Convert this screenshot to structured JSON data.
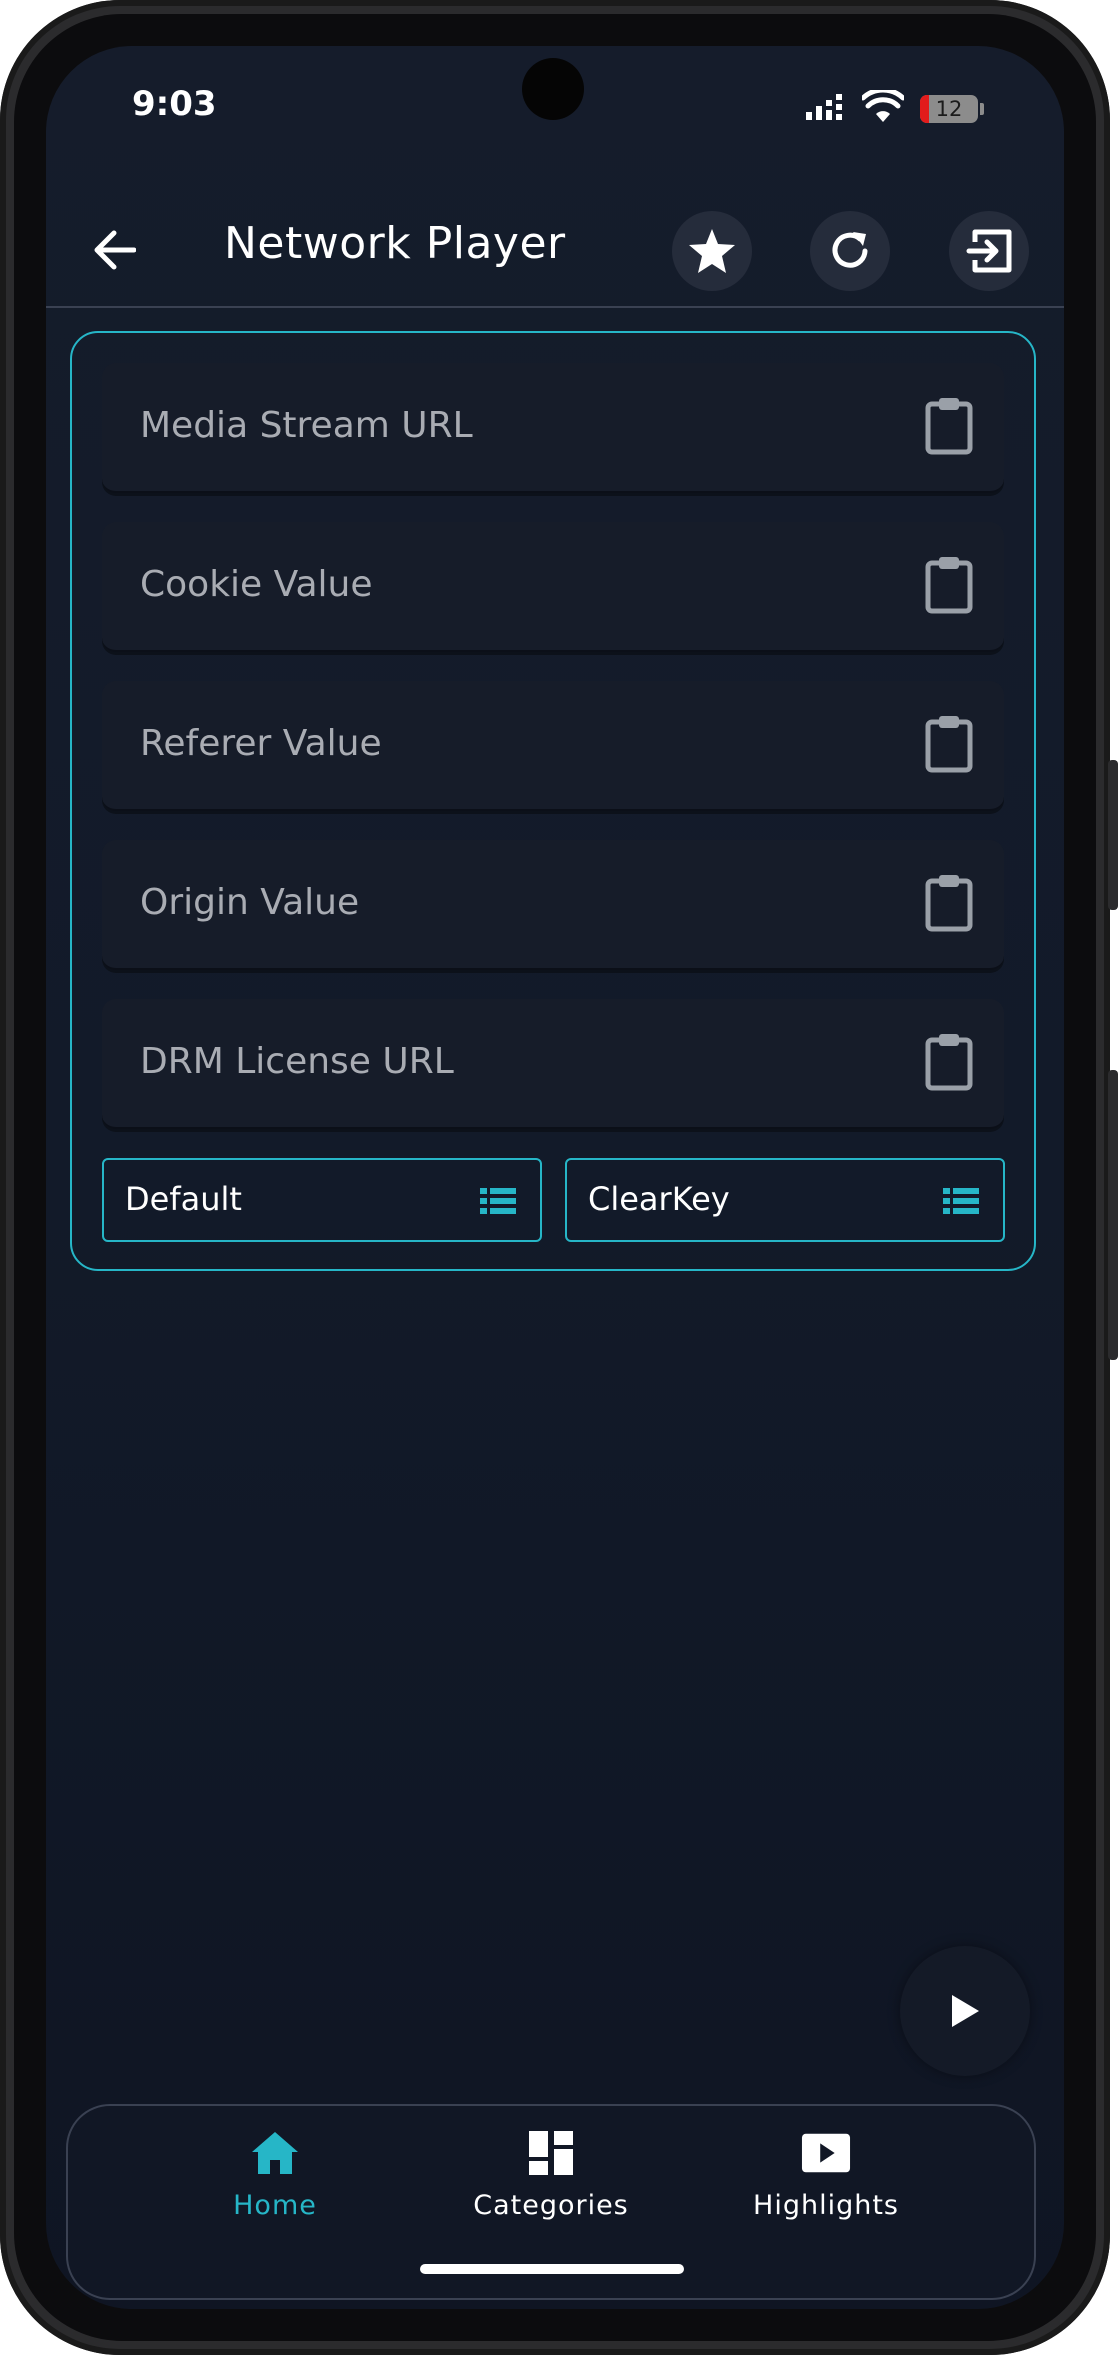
{
  "status_bar": {
    "time": "9:03",
    "battery_level": "12",
    "icons": [
      "signal-icon",
      "wifi-icon",
      "battery-icon"
    ]
  },
  "app_bar": {
    "title": "Network Player",
    "actions": [
      "star-icon",
      "refresh-icon",
      "exit-icon"
    ]
  },
  "form": {
    "fields": [
      {
        "placeholder": "Media Stream URL"
      },
      {
        "placeholder": "Cookie Value"
      },
      {
        "placeholder": "Referer Value"
      },
      {
        "placeholder": "Origin Value"
      },
      {
        "placeholder": "DRM License URL"
      }
    ],
    "selects": [
      {
        "value": "Default"
      },
      {
        "value": "ClearKey"
      }
    ]
  },
  "bottom_nav": {
    "items": [
      {
        "label": "Home",
        "icon": "home-icon",
        "active": true
      },
      {
        "label": "Categories",
        "icon": "categories-icon",
        "active": false
      },
      {
        "label": "Highlights",
        "icon": "highlights-icon",
        "active": false
      }
    ]
  },
  "colors": {
    "accent": "#26b6c7",
    "background": "#121a29",
    "field_bg": "#161c29",
    "placeholder_text": "#a9acb3"
  }
}
